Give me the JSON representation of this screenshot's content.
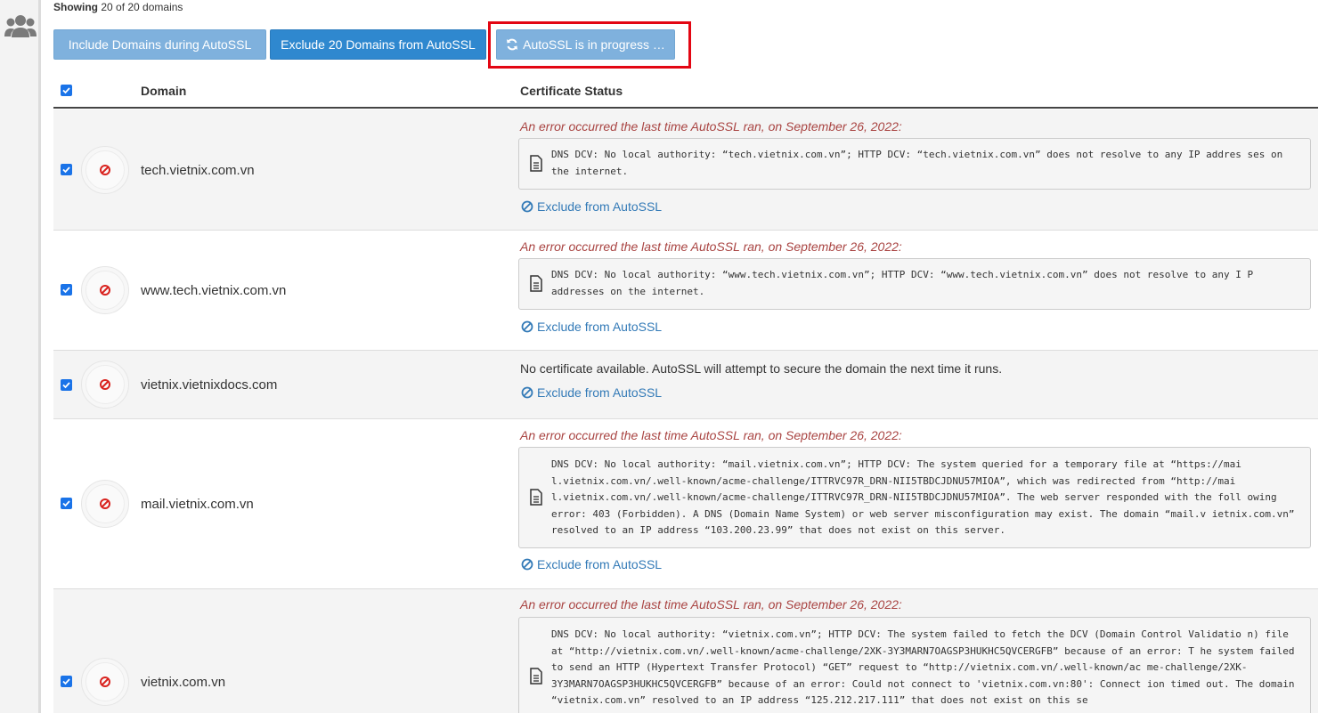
{
  "showing": {
    "label": "Showing",
    "count_text": "20 of 20 domains"
  },
  "buttons": {
    "include": "Include Domains during AutoSSL",
    "exclude": "Exclude 20 Domains from AutoSSL",
    "progress": "AutoSSL is in progress …"
  },
  "table": {
    "header_domain": "Domain",
    "header_status": "Certificate Status"
  },
  "exclude_link": "Exclude from AutoSSL",
  "rows": [
    {
      "domain": "tech.vietnix.com.vn",
      "error_title": "An error occurred the last time AutoSSL ran, on September 26, 2022:",
      "message": "DNS DCV: No local authority: “tech.vietnix.com.vn”; HTTP DCV: “tech.vietnix.com.vn” does not resolve to any IP addres ses on the internet."
    },
    {
      "domain": "www.tech.vietnix.com.vn",
      "error_title": "An error occurred the last time AutoSSL ran, on September 26, 2022:",
      "message": "DNS DCV: No local authority: “www.tech.vietnix.com.vn”; HTTP DCV: “www.tech.vietnix.com.vn” does not resolve to any I P addresses on the internet."
    },
    {
      "domain": "vietnix.vietnixdocs.com",
      "status_text": "No certificate available. AutoSSL will attempt to secure the domain the next time it runs."
    },
    {
      "domain": "mail.vietnix.com.vn",
      "error_title": "An error occurred the last time AutoSSL ran, on September 26, 2022:",
      "message": "DNS DCV: No local authority: “mail.vietnix.com.vn”; HTTP DCV: The system queried for a temporary file at “https://mai l.vietnix.com.vn/.well-known/acme-challenge/ITTRVC97R_DRN-NII5TBDCJDNU57MIOA”, which was redirected from “http://mai l.vietnix.com.vn/.well-known/acme-challenge/ITTRVC97R_DRN-NII5TBDCJDNU57MIOA”. The web server responded with the foll owing error: 403 (Forbidden). A DNS (Domain Name System) or web server misconfiguration may exist. The domain “mail.v ietnix.com.vn” resolved to an IP address “103.200.23.99” that does not exist on this server."
    },
    {
      "domain": "vietnix.com.vn",
      "error_title": "An error occurred the last time AutoSSL ran, on September 26, 2022:",
      "message": "DNS DCV: No local authority: “vietnix.com.vn”; HTTP DCV: The system failed to fetch the DCV (Domain Control Validatio n) file at “http://vietnix.com.vn/.well-known/acme-challenge/2XK-3Y3MARN7OAGSP3HUKHC5QVCERGFB” because of an error: T he system failed to send an HTTP (Hypertext Transfer Protocol) “GET” request to “http://vietnix.com.vn/.well-known/ac me-challenge/2XK-3Y3MARN7OAGSP3HUKHC5QVCERGFB” because of an error: Could not connect to 'vietnix.com.vn:80': Connect ion timed out. The domain “vietnix.com.vn” resolved to an IP address “125.212.217.111” that does not exist on this se"
    }
  ],
  "colors": {
    "error_red": "#a94442",
    "link_blue": "#337ab7",
    "highlight": "#e30613"
  }
}
